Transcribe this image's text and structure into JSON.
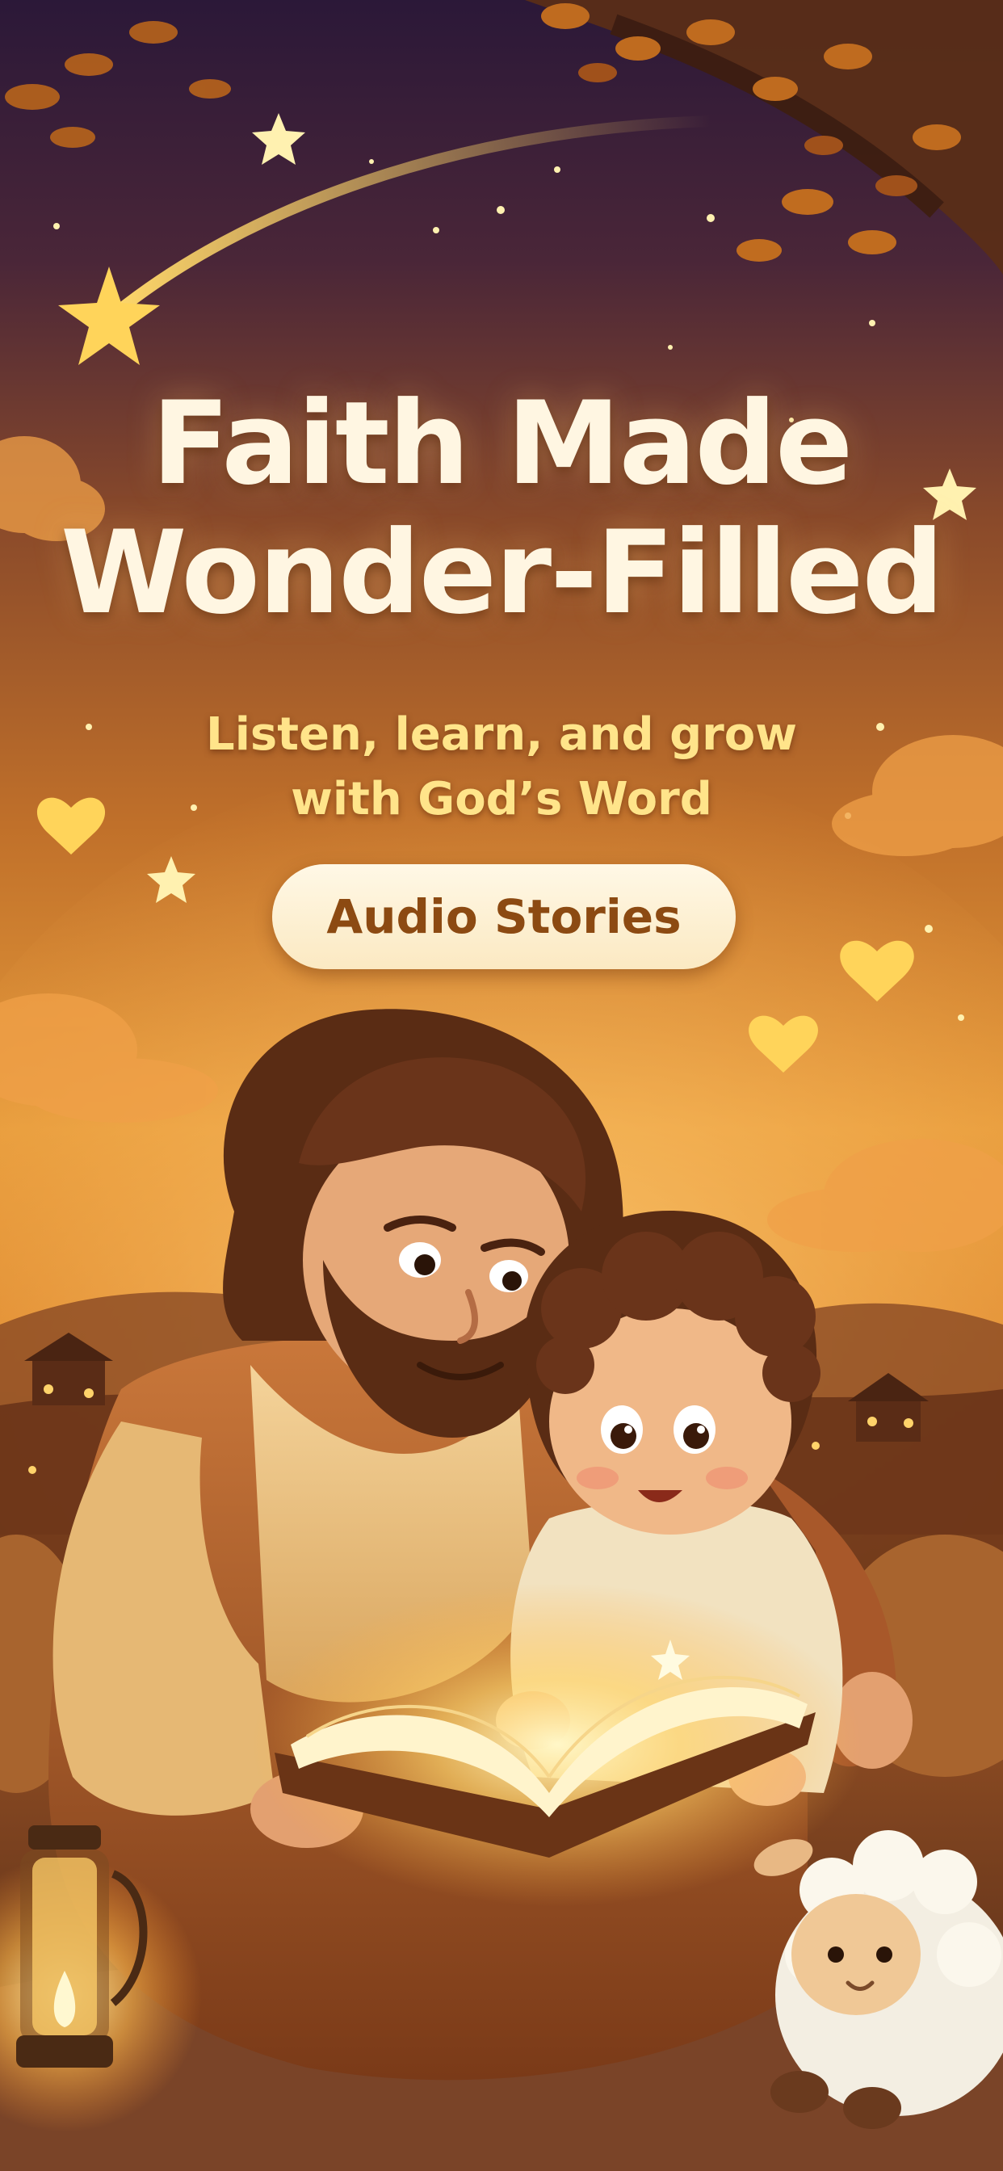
{
  "headline": {
    "line1": "Faith Made",
    "line2": "Wonder-Filled"
  },
  "subtitle": {
    "line1": "Listen, learn, and grow",
    "line2": "with God’s Word"
  },
  "cta": {
    "label": "Audio Stories"
  },
  "colors": {
    "headline": "#fff6e2",
    "subtitle": "#ffe48a",
    "pill_bg": "#fff8e6",
    "pill_text": "#8c4a12",
    "sky_top": "#2b1838",
    "sky_glow": "#e59a3a"
  },
  "illustration": {
    "elements": [
      "shooting-star",
      "tree-branch",
      "stars",
      "hearts",
      "clouds",
      "village-hills",
      "father-figure",
      "child",
      "glowing-book",
      "lantern",
      "sheep-plush"
    ]
  }
}
